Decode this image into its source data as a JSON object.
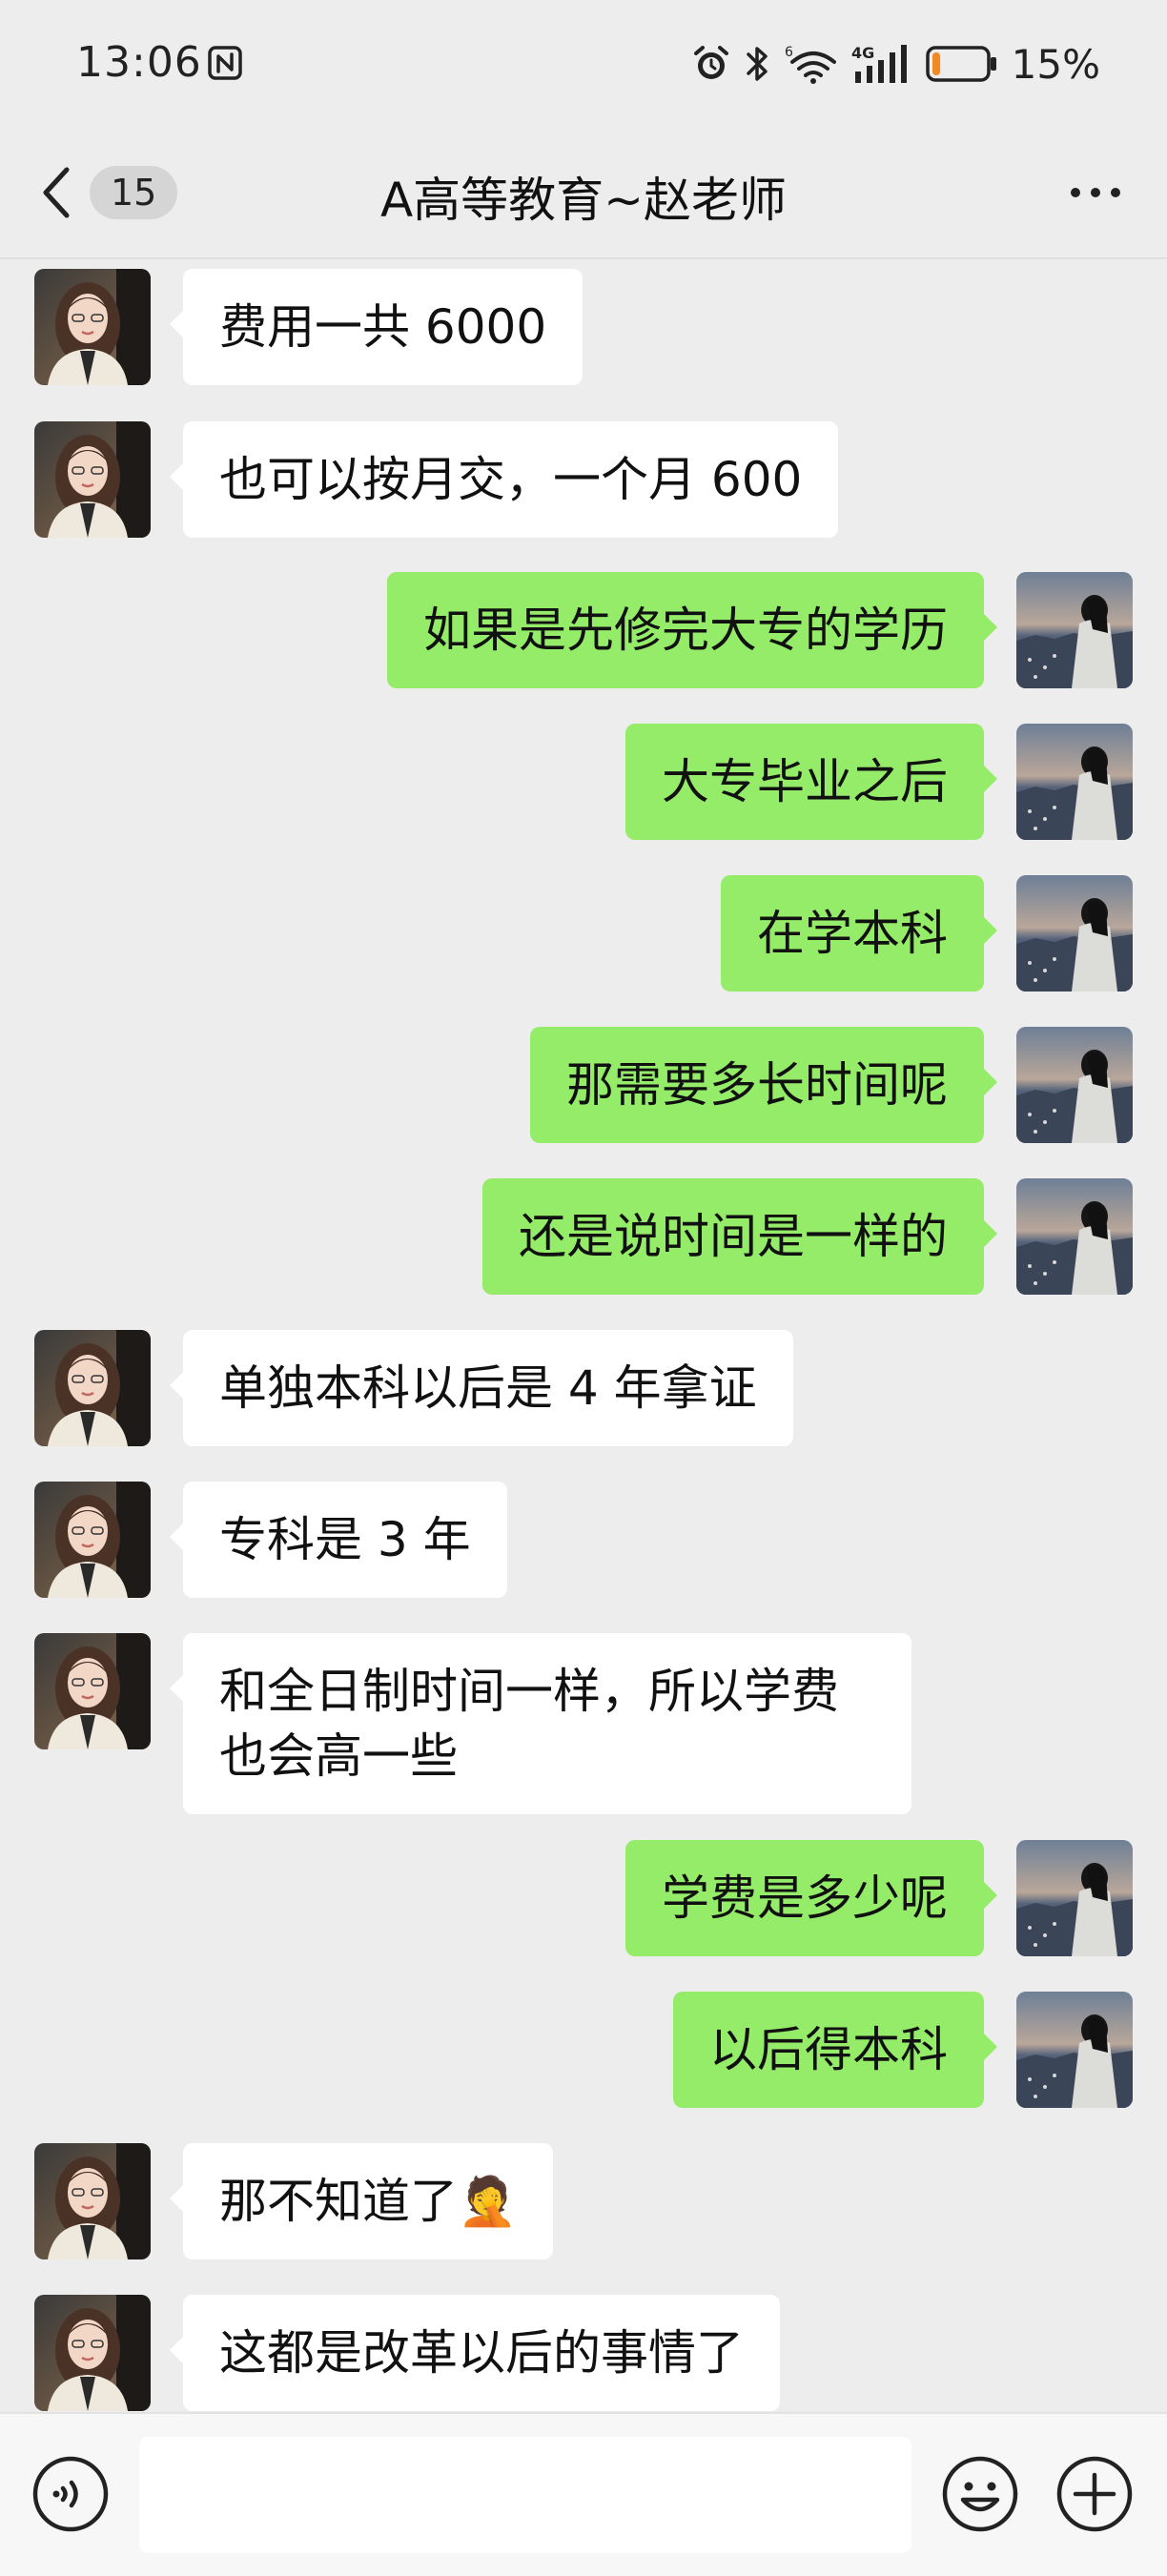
{
  "status_bar": {
    "time": "13:06",
    "signal_label": "4G",
    "battery_text": "15%",
    "battery_level": 0.15,
    "battery_color": "#f08a24"
  },
  "header": {
    "back_count": "15",
    "title": "A高等教育~赵老师"
  },
  "colors": {
    "background": "#ededed",
    "outgoing_bubble": "#95ec69",
    "incoming_bubble": "#ffffff"
  },
  "messages": [
    {
      "side": "left",
      "text": "费用一共 6000"
    },
    {
      "side": "left",
      "text": "也可以按月交，一个月 600"
    },
    {
      "side": "right",
      "text": "如果是先修完大专的学历"
    },
    {
      "side": "right",
      "text": "大专毕业之后"
    },
    {
      "side": "right",
      "text": "在学本科"
    },
    {
      "side": "right",
      "text": "那需要多长时间呢"
    },
    {
      "side": "right",
      "text": "还是说时间是一样的"
    },
    {
      "side": "left",
      "text": "单独本科以后是 4 年拿证"
    },
    {
      "side": "left",
      "text": "专科是 3 年"
    },
    {
      "side": "left",
      "text": "和全日制时间一样，所以学费也会高一些"
    },
    {
      "side": "right",
      "text": "学费是多少呢"
    },
    {
      "side": "right",
      "text": "以后得本科"
    },
    {
      "side": "left",
      "text": "那不知道了🤦"
    },
    {
      "side": "left",
      "text": "这都是改革以后的事情了"
    }
  ],
  "input": {
    "value": "",
    "placeholder": ""
  },
  "icons": {
    "back": "chevron-left-icon",
    "more": "more-horizontal-icon",
    "voice": "voice-input-icon",
    "emoji": "emoji-icon",
    "plus": "plus-icon"
  }
}
